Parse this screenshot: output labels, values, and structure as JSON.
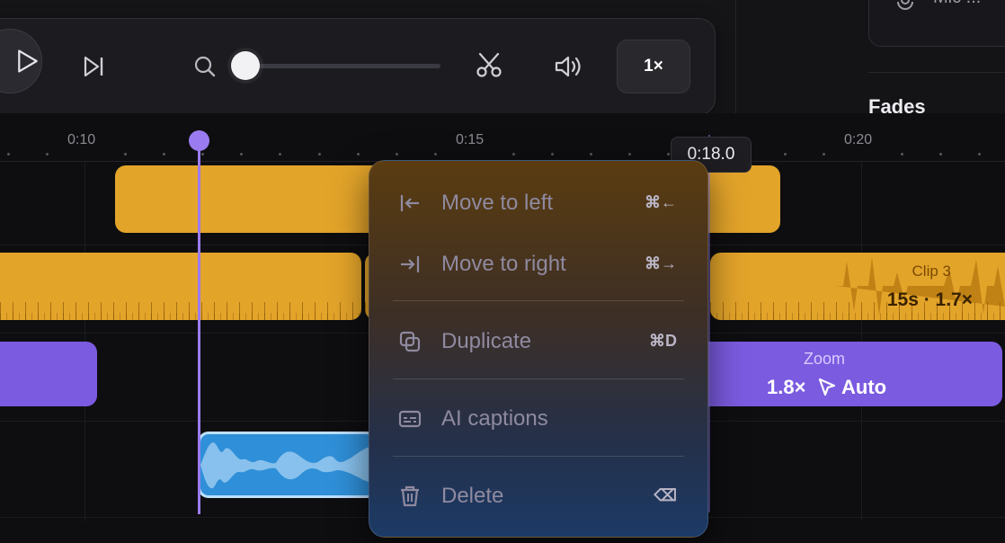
{
  "toolbar": {
    "speed_label": "1×",
    "zoom_slider_value": 0.0
  },
  "panel": {
    "mic_text": "Mic ...",
    "section_heading": "Fades"
  },
  "ruler": {
    "ticks": [
      "0:10",
      "0:15",
      "0:20"
    ]
  },
  "playhead": {
    "hover_time": "0:18.0"
  },
  "clips": {
    "clip3_title": "Clip 3",
    "clip3_meta": "15s · 1.7×"
  },
  "zoom_block": {
    "label": "Zoom",
    "amount": "1.8×",
    "mode": "Auto"
  },
  "context_menu": {
    "items": [
      {
        "label": "Move to left",
        "shortcut": "⌘←",
        "icon": "arrow-to-left-icon"
      },
      {
        "label": "Move to right",
        "shortcut": "⌘→",
        "icon": "arrow-to-right-icon"
      },
      {
        "label": "Duplicate",
        "shortcut": "⌘D",
        "icon": "duplicate-icon"
      },
      {
        "label": "AI captions",
        "shortcut": "",
        "icon": "captions-icon"
      },
      {
        "label": "Delete",
        "shortcut": "⌫",
        "icon": "trash-icon"
      }
    ]
  },
  "colors": {
    "clip_yellow": "#e3a42a",
    "zoom_purple": "#7b5be0",
    "audio_blue": "#2f8fd8",
    "playhead": "#9b7cf0"
  }
}
